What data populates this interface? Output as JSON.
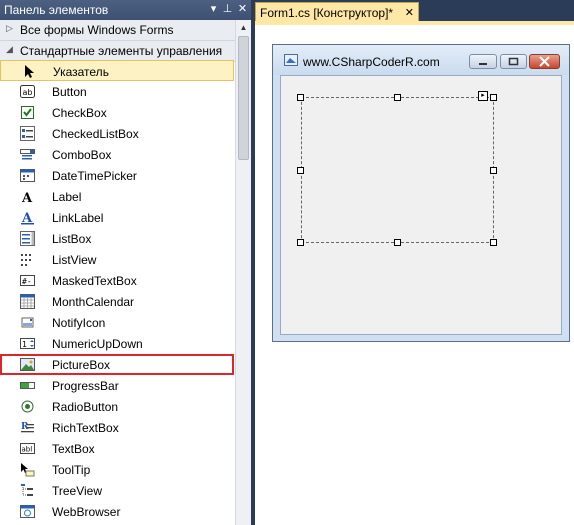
{
  "toolbox": {
    "title": "Панель элементов",
    "categories": [
      {
        "label": "Все формы Windows Forms",
        "expanded": false
      },
      {
        "label": "Стандартные элементы управления",
        "expanded": true
      }
    ],
    "items": [
      {
        "label": "Указатель",
        "icon": "pointer-icon",
        "selected": true
      },
      {
        "label": "Button",
        "icon": "button-icon"
      },
      {
        "label": "CheckBox",
        "icon": "checkbox-icon"
      },
      {
        "label": "CheckedListBox",
        "icon": "checkedlistbox-icon"
      },
      {
        "label": "ComboBox",
        "icon": "combobox-icon"
      },
      {
        "label": "DateTimePicker",
        "icon": "datetimepicker-icon"
      },
      {
        "label": "Label",
        "icon": "label-icon"
      },
      {
        "label": "LinkLabel",
        "icon": "linklabel-icon"
      },
      {
        "label": "ListBox",
        "icon": "listbox-icon"
      },
      {
        "label": "ListView",
        "icon": "listview-icon"
      },
      {
        "label": "MaskedTextBox",
        "icon": "maskedtextbox-icon"
      },
      {
        "label": "MonthCalendar",
        "icon": "monthcalendar-icon"
      },
      {
        "label": "NotifyIcon",
        "icon": "notifyicon-icon"
      },
      {
        "label": "NumericUpDown",
        "icon": "numericupdown-icon"
      },
      {
        "label": "PictureBox",
        "icon": "picturebox-icon",
        "highlighted": true
      },
      {
        "label": "ProgressBar",
        "icon": "progressbar-icon"
      },
      {
        "label": "RadioButton",
        "icon": "radiobutton-icon"
      },
      {
        "label": "RichTextBox",
        "icon": "richtextbox-icon"
      },
      {
        "label": "TextBox",
        "icon": "textbox-icon"
      },
      {
        "label": "ToolTip",
        "icon": "tooltip-icon"
      },
      {
        "label": "TreeView",
        "icon": "treeview-icon"
      },
      {
        "label": "WebBrowser",
        "icon": "webbrowser-icon"
      }
    ]
  },
  "document_tab": {
    "label": "Form1.cs [Конструктор]*"
  },
  "form": {
    "title": "www.CSharpCoderR.com"
  },
  "colors": {
    "highlight": "#e0252a",
    "selected_bg": "#fdf2c4",
    "chrome": "#2b3c59"
  }
}
